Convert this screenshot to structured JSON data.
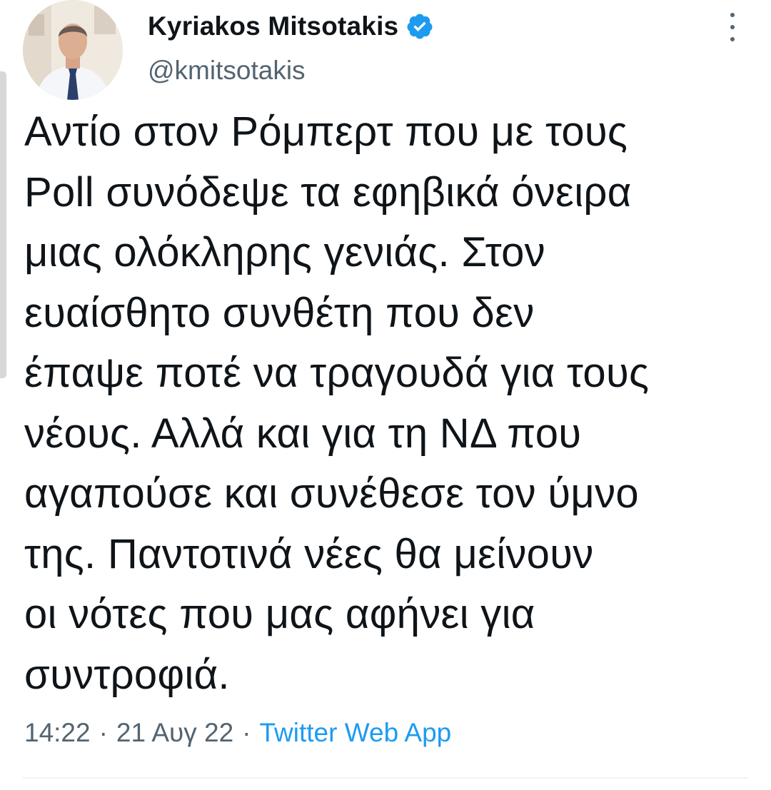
{
  "author": {
    "display_name": "Kyriakos Mitsotakis",
    "handle": "@kmitsotakis",
    "verified": true,
    "avatar_icon": "profile-photo",
    "verified_icon": "verified-badge-icon",
    "verified_color": "#1d9bf0"
  },
  "tweet": {
    "lines": [
      "Αντίο στον Ρόμπερτ που με τους",
      "Poll συνόδεψε τα εφηβικά όνειρα",
      "μιας ολόκληρης γενιάς. Στον",
      "ευαίσθητο συνθέτη που δεν",
      "έπαψε ποτέ να τραγουδά για τους",
      "νέους. Αλλά και για τη ΝΔ που",
      "αγαπούσε και συνέθεσε τον ύμνο",
      "της. Παντοτινά νέες θα μείνουν",
      "οι νότες που μας αφήνει για",
      "συντροφιά."
    ],
    "time": "14:22",
    "separator": "·",
    "date": "21 Αυγ 22",
    "source": "Twitter Web App"
  },
  "menu": {
    "more_icon": "more-vertical-icon"
  },
  "colors": {
    "text_primary": "#0f1419",
    "text_secondary": "#536471",
    "link": "#1d9bf0",
    "divider": "#eff3f4"
  }
}
